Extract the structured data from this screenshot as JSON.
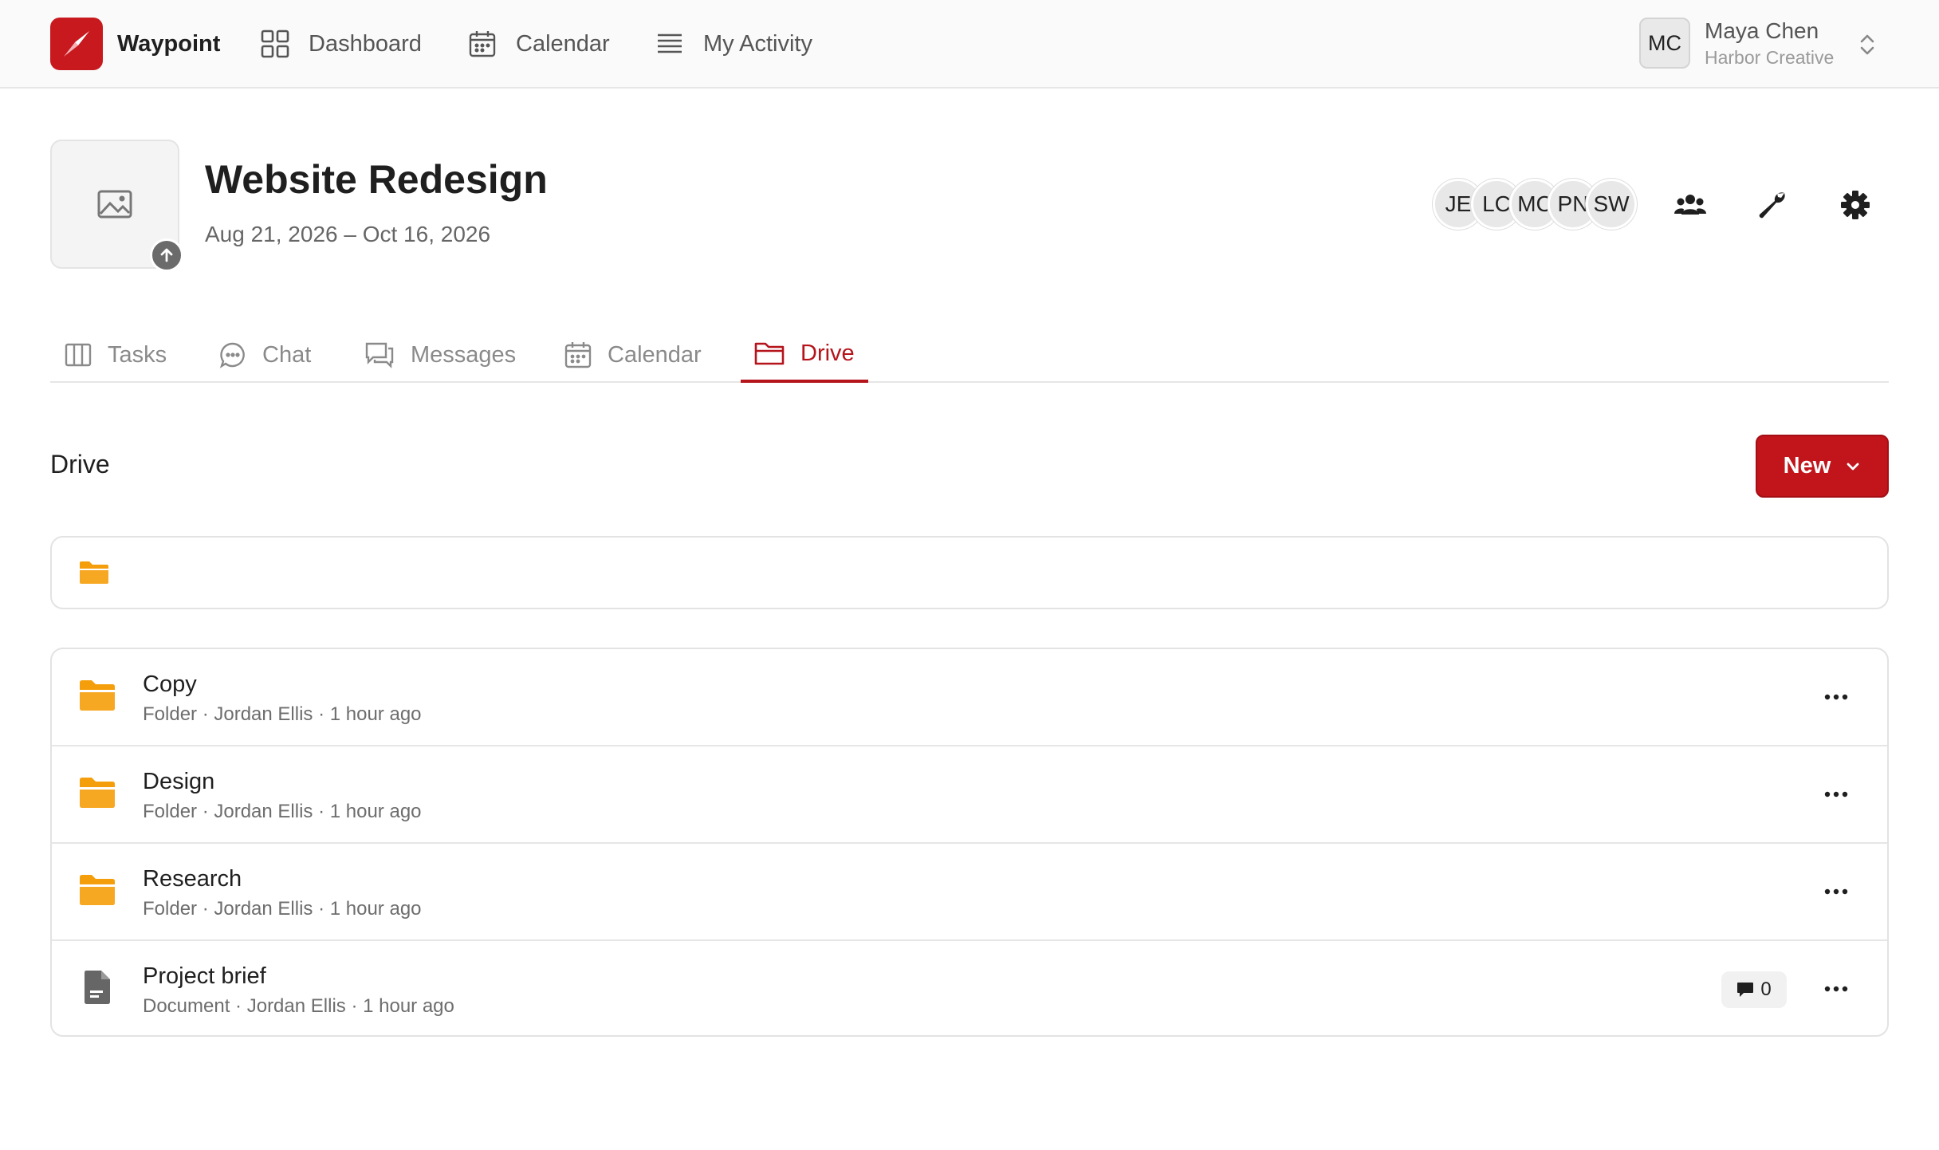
{
  "brand": {
    "name": "Waypoint",
    "logo_color": "#c8191f"
  },
  "nav": {
    "items": [
      {
        "label": "Dashboard",
        "icon": "grid-icon"
      },
      {
        "label": "Calendar",
        "icon": "calendar-icon"
      },
      {
        "label": "My Activity",
        "icon": "list-icon"
      }
    ]
  },
  "user": {
    "initials": "MC",
    "name": "Maya Chen",
    "organization": "Harbor Creative"
  },
  "project": {
    "title": "Website Redesign",
    "dates": "Aug 21, 2026 – Oct 16, 2026",
    "members": [
      "JE",
      "LC",
      "MC",
      "PN",
      "SW"
    ]
  },
  "tabs": [
    {
      "label": "Tasks",
      "icon": "columns-icon",
      "active": false
    },
    {
      "label": "Chat",
      "icon": "chat-bubble-icon",
      "active": false
    },
    {
      "label": "Messages",
      "icon": "messages-icon",
      "active": false
    },
    {
      "label": "Calendar",
      "icon": "calendar-icon",
      "active": false
    },
    {
      "label": "Drive",
      "icon": "folder-outline-icon",
      "active": true
    }
  ],
  "drive": {
    "title": "Drive",
    "new_button_label": "New",
    "files": [
      {
        "name": "Copy",
        "type": "Folder",
        "owner": "Jordan Ellis",
        "time": "1 hour ago"
      },
      {
        "name": "Design",
        "type": "Folder",
        "owner": "Jordan Ellis",
        "time": "1 hour ago"
      },
      {
        "name": "Research",
        "type": "Folder",
        "owner": "Jordan Ellis",
        "time": "1 hour ago"
      },
      {
        "name": "Project brief",
        "type": "Document",
        "owner": "Jordan Ellis",
        "time": "1 hour ago",
        "comments": "0"
      }
    ]
  },
  "colors": {
    "accent": "#c1141b",
    "folder": "#f59e0b",
    "active_tab": "#b5141b"
  }
}
